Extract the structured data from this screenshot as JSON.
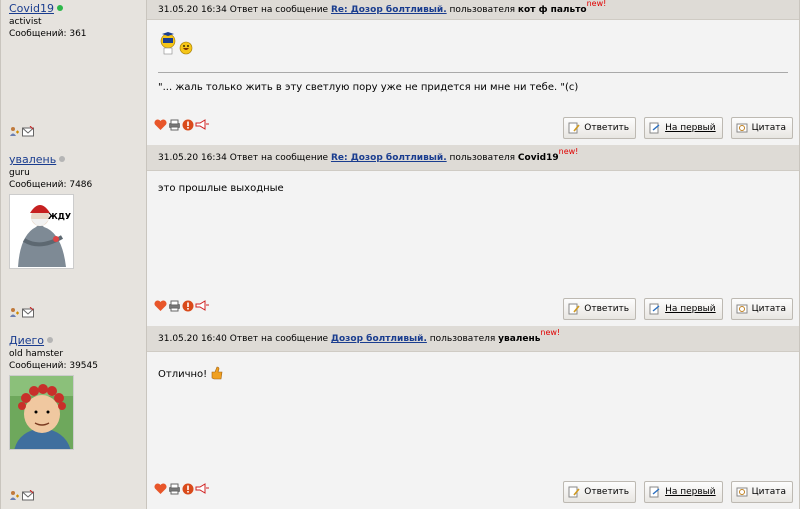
{
  "posts": [
    {
      "author": "Covid19",
      "online": true,
      "rank": "activist",
      "messages": "Сообщений: 361",
      "date": "31.05.20 16:34",
      "reply_prefix": "Ответ на сообщение",
      "topic": "Re: Дозор болтливый.",
      "user_prefix": "пользователя",
      "reply_to": "кот ф пальто",
      "new_tag": "new!",
      "quote": "\"... жаль только жить в эту светлую пору уже не придется ни мне ни тебе. \"(с)"
    },
    {
      "author": "увалень",
      "online": false,
      "rank": "guru",
      "messages": "Сообщений: 7486",
      "date": "31.05.20 16:34",
      "reply_prefix": "Ответ на сообщение",
      "topic": "Re: Дозор болтливый.",
      "user_prefix": "пользователя",
      "reply_to": "Covid19",
      "new_tag": "new!",
      "text": "это прошлые выходные",
      "avatar_text": "ЖДУ НГ..."
    },
    {
      "author": "Диего",
      "online": false,
      "rank": "old hamster",
      "messages": "Сообщений: 39545",
      "date": "31.05.20 16:40",
      "reply_prefix": "Ответ на сообщение",
      "topic": "Дозор болтливый.",
      "user_prefix": "пользователя",
      "reply_to": "увалень",
      "new_tag": "new!",
      "text": "Отлично!"
    }
  ],
  "buttons": {
    "reply": "Ответить",
    "to_first": "На первый",
    "quote": "Цитата"
  },
  "colors": {
    "online": "#2db84a",
    "offline": "#b5b5b5",
    "link": "#1a3d8f",
    "new": "#e00000"
  }
}
